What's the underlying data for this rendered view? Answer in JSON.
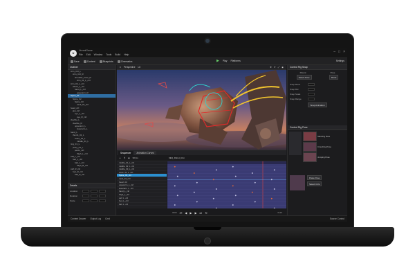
{
  "app": {
    "project_name": "UnrealGame",
    "menu": [
      "File",
      "Edit",
      "Window",
      "Tools",
      "Build",
      "Help"
    ]
  },
  "toolbar": {
    "items": [
      "Save",
      "Content",
      "Blueprints",
      "Cinematics"
    ],
    "play_label": "Play",
    "platforms_label": "Platforms",
    "settings_label": "Settings"
  },
  "outliner": {
    "tab_label": "Outliner",
    "rows": [
      "Arm_Ctrl_L",
      "Arm_Ctrl_R",
      "shoulder_bone_R",
      "Arm_01_L_ctrl",
      "Arm_02_L_ctrl",
      "elbow_L_ctrl",
      "hand_L_ctrl",
      "upperarm_R",
      "Spine_01",
      "Spine_02",
      "Spine_03",
      "neck_01_ctrl",
      "head_ctrl",
      "jaw_ctrl",
      "eye_L_ctrl",
      "eye_R_ctrl",
      "clavicle_L",
      "clavicle_R",
      "upperarm_L",
      "lowerarm_L",
      "hand_L",
      "thumb_01_L",
      "index_01_L",
      "middle_01_L",
      "ring_01_L",
      "pinky_01_L",
      "pelvis_ctrl",
      "thigh_L_ctrl",
      "calf_L_ctrl",
      "foot_L_ctrl",
      "ball_L_ctrl",
      "thigh_R_ctrl",
      "calf_R_ctrl",
      "foot_R_ctrl",
      "ball_R_ctrl"
    ],
    "selected_index": 8
  },
  "details": {
    "tab_label": "Details",
    "rows": [
      "Location",
      "Rotation",
      "Scale"
    ]
  },
  "viewport": {
    "tab_label": "Perspective",
    "mode_label": "Lit"
  },
  "control_rig": {
    "title": "Control Rig Snap",
    "left_label": "Parent",
    "right_label": "Pose",
    "left_button": "Select Actor",
    "right_button": "Mode",
    "rows": [
      "Snap Move",
      "Snap Rot",
      "Snap Scale",
      "Snap Range"
    ],
    "action_button": "Snap Animation"
  },
  "pose_library": {
    "title": "Control Rig Pose",
    "items": [
      "Standing Pose",
      "Crouching Pose",
      "Jumping Pose"
    ],
    "footer_button": "Paste Pose",
    "select_button": "Select Ctrls"
  },
  "sequencer": {
    "tabs": [
      "Sequencer",
      "Animation Curves"
    ],
    "fps_label": "30 fps",
    "sequence_name": "SEQ_Robot_Run",
    "tracks": [
      "middle_01_L_ctrl",
      "middle_02_L_ctrl",
      "middle_03_L_ctrl",
      "pinky_01_L_ctrl",
      "Spine_03_ctrl",
      "neck_01_ctrl",
      "head_ctrl",
      "upperarm_L_ctrl",
      "lowerarm_L_ctrl",
      "hand_L_ctrl",
      "thigh_L_ctrl",
      "calf_L_ctrl",
      "foot_L_ctrl",
      "ball_L_ctrl"
    ],
    "selected_track": 4,
    "time_start": "0000",
    "time_end": "0120"
  },
  "status": {
    "left": "Content Drawer",
    "output": "Output Log",
    "cmd": "Cmd",
    "right": "Source Control"
  }
}
